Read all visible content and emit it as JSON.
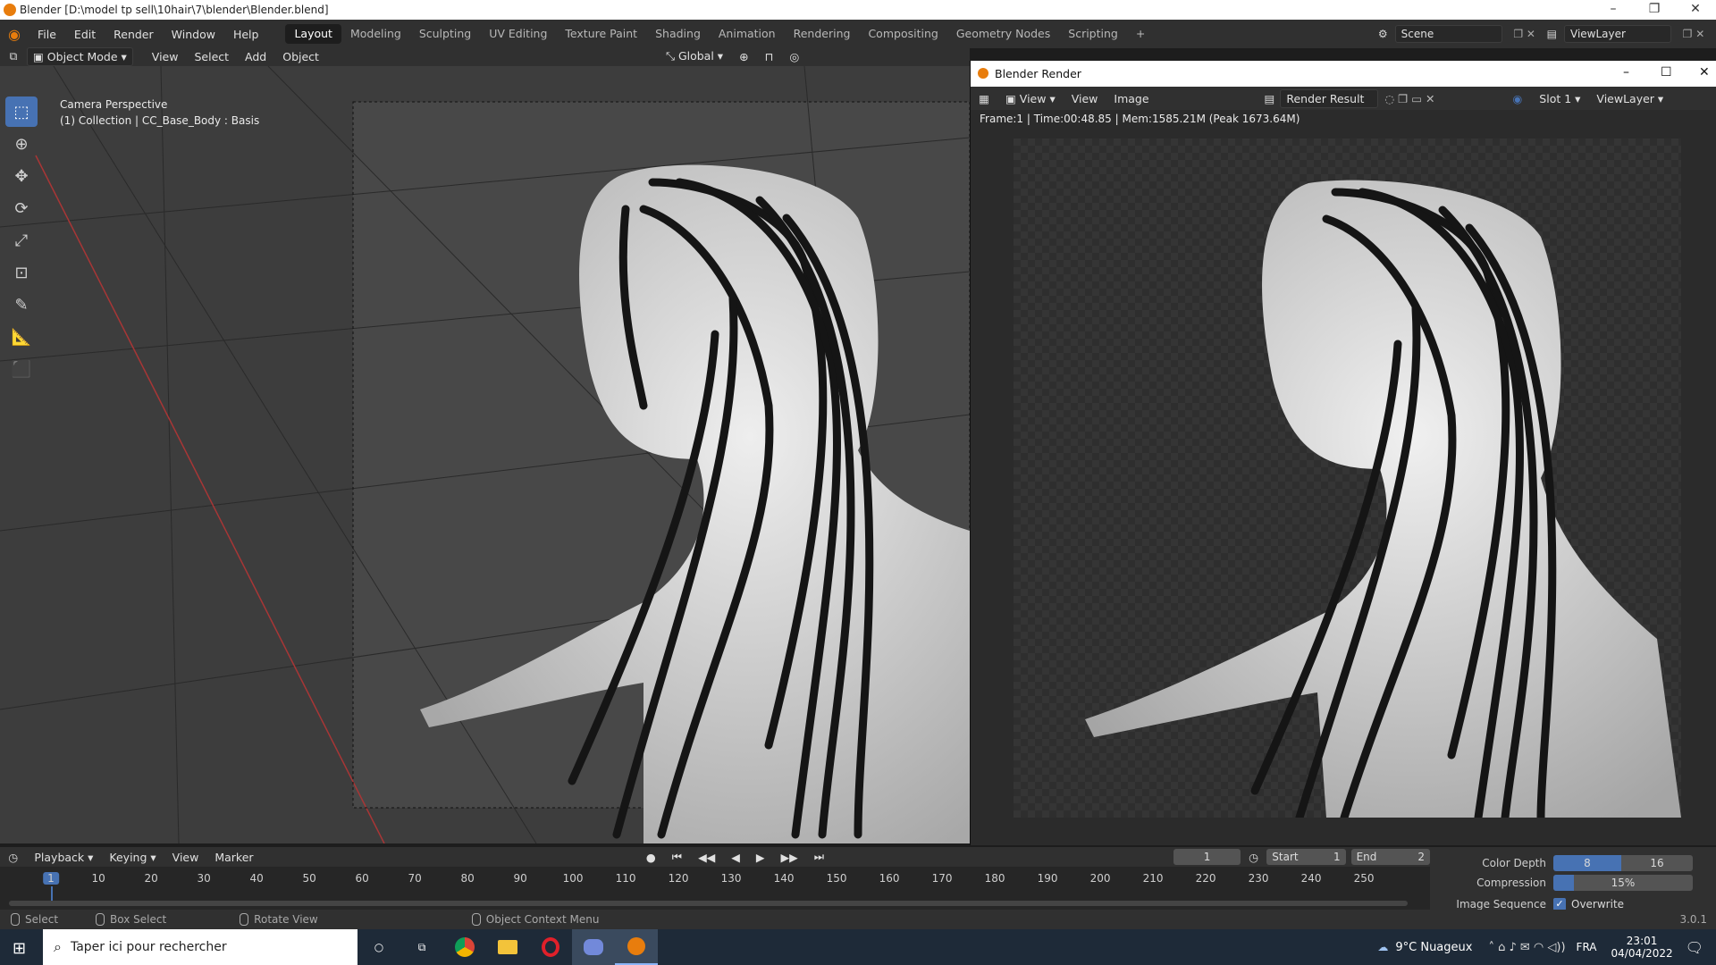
{
  "window": {
    "title": "Blender [D:\\model tp sell\\10hair\\7\\blender\\Blender.blend]",
    "controls": [
      "–",
      "❐",
      "✕"
    ]
  },
  "menu": [
    "File",
    "Edit",
    "Render",
    "Window",
    "Help"
  ],
  "workspaces": [
    "Layout",
    "Modeling",
    "Sculpting",
    "UV Editing",
    "Texture Paint",
    "Shading",
    "Animation",
    "Rendering",
    "Compositing",
    "Geometry Nodes",
    "Scripting"
  ],
  "active_workspace": "Layout",
  "scene": {
    "scene_name": "Scene",
    "view_layer": "ViewLayer"
  },
  "header": {
    "mode": "Object Mode",
    "menus": [
      "View",
      "Select",
      "Add",
      "Object"
    ],
    "transform_orientation": "Global"
  },
  "viewport": {
    "overlay_title": "Camera Perspective",
    "overlay_subtitle": "(1) Collection | CC_Base_Body : Basis"
  },
  "tools": [
    "select-box-icon",
    "cursor-icon",
    "move-icon",
    "rotate-icon",
    "scale-icon",
    "transform-icon",
    "annotate-icon",
    "measure-icon",
    "add-cube-icon"
  ],
  "render_window": {
    "title": "Blender Render",
    "menus": [
      "View",
      "View",
      "Image"
    ],
    "image_name": "Render Result",
    "slot": "Slot 1",
    "view_layer": "ViewLayer",
    "stats": "Frame:1 | Time:00:48.85 | Mem:1585.21M (Peak 1673.64M)"
  },
  "timeline": {
    "menus": [
      "Playback",
      "Keying",
      "View",
      "Marker"
    ],
    "current_frame": "1",
    "start_label": "Start",
    "start": "1",
    "end_label": "End",
    "end": "2",
    "ticks": [
      "1",
      "10",
      "20",
      "30",
      "40",
      "50",
      "60",
      "70",
      "80",
      "90",
      "100",
      "110",
      "120",
      "130",
      "140",
      "150",
      "160",
      "170",
      "180",
      "190",
      "200",
      "210",
      "220",
      "230",
      "240",
      "250"
    ]
  },
  "properties": {
    "color_depth_label": "Color Depth",
    "color_depth_opt1": "8",
    "color_depth_opt2": "16",
    "compression_label": "Compression",
    "compression_value": "15%",
    "compression_fraction": 0.15,
    "image_sequence_label": "Image Sequence",
    "overwrite_label": "Overwrite"
  },
  "status": {
    "select": "Select",
    "box_select": "Box Select",
    "rotate_view": "Rotate View",
    "context_menu": "Object Context Menu",
    "version": "3.0.1"
  },
  "taskbar": {
    "search_placeholder": "Taper ici pour rechercher",
    "weather": "9°C  Nuageux",
    "language": "FRA",
    "time": "23:01",
    "date": "04/04/2022"
  },
  "colors": {
    "accent": "#4772b3",
    "blender_orange": "#e87d0d"
  }
}
